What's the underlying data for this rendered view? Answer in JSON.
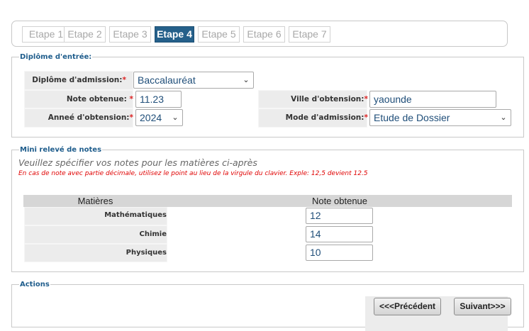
{
  "steps": [
    {
      "label": "Etape 1"
    },
    {
      "label": "Etape 2"
    },
    {
      "label": "Etape 3"
    },
    {
      "label": "Etape 4"
    },
    {
      "label": "Etape 5"
    },
    {
      "label": "Etape 6"
    },
    {
      "label": "Etape 7"
    }
  ],
  "active_step": "Etape 4",
  "diplome": {
    "legend": "Diplôme d'entrée:",
    "diplome_admission_label": "Diplôme d'admission:",
    "diplome_admission_value": "Baccalauréat",
    "note_label": "Note obtenue:",
    "note_value": "11.23",
    "annee_label": "Anneé d'obtension:",
    "annee_value": "2024",
    "ville_label": "Ville d'obtension:",
    "ville_value": "yaounde",
    "mode_label": "Mode d'admission:",
    "mode_value": "Etude de Dossier",
    "required_mark": "*"
  },
  "notes": {
    "legend": "Mini relevé de notes",
    "intro": "Veuillez spécifier vos notes pour les matières ci-après",
    "hint": "En cas de note avec partie décimale, utilisez le point au lieu de la virgule du clavier. Exple: 12,5 devient 12.5",
    "col_subject": "Matières",
    "col_grade": "Note obtenue",
    "rows": [
      {
        "subject": "Mathématiques",
        "grade": "12"
      },
      {
        "subject": "Chimie",
        "grade": "14"
      },
      {
        "subject": "Physiques",
        "grade": "10"
      }
    ]
  },
  "actions": {
    "legend": "Actions",
    "prev_label": "<<<Précédent",
    "next_label": "Suivant>>>"
  },
  "colors": {
    "accent": "#25608a",
    "legend": "#1f5d8c",
    "required": "#dd2222",
    "hint": "#e00000"
  }
}
